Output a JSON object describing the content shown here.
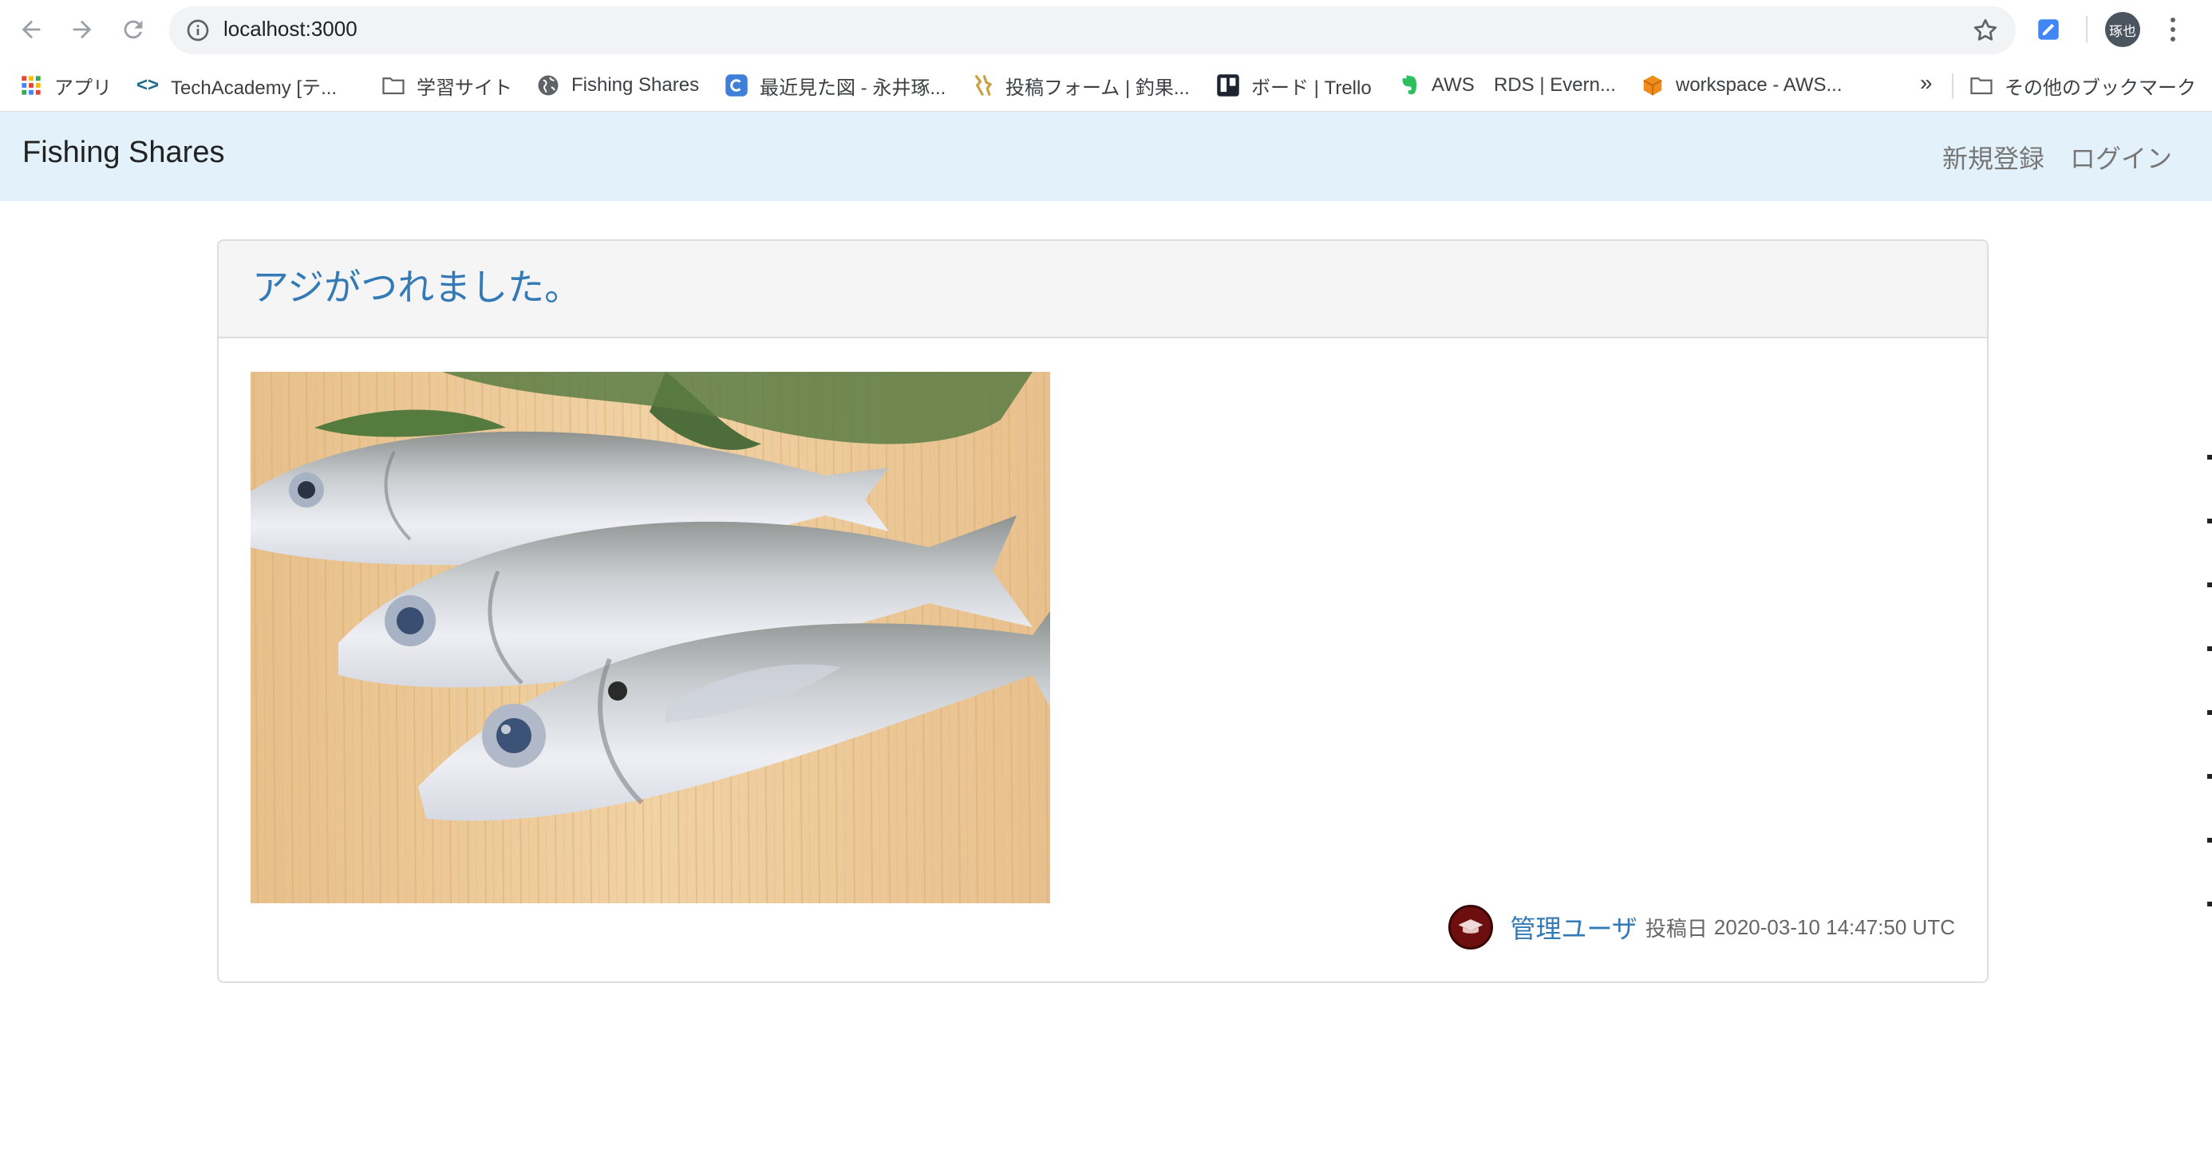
{
  "browser": {
    "url": "localhost:3000",
    "profile_initials": "琢也"
  },
  "bookmarks": {
    "items": [
      {
        "label": "アプリ",
        "icon": "apps-grid-icon"
      },
      {
        "label": "TechAcademy [テ...",
        "icon": "code-brackets-icon"
      },
      {
        "label": "学習サイト",
        "icon": "folder-icon"
      },
      {
        "label": "Fishing Shares",
        "icon": "globe-icon"
      },
      {
        "label": "最近見た図 - 永井琢...",
        "icon": "cacoo-icon"
      },
      {
        "label": "投稿フォーム | 釣果...",
        "icon": "bookmark-figure-icon"
      },
      {
        "label": "ボード | Trello",
        "icon": "trello-icon"
      },
      {
        "label": "AWS",
        "icon": "evernote-icon"
      },
      {
        "label": "RDS | Evern...",
        "icon": ""
      },
      {
        "label": "workspace - AWS...",
        "icon": "aws-cube-icon"
      }
    ],
    "more_label": "»",
    "other_label": "その他のブックマーク"
  },
  "app": {
    "brand": "Fishing Shares",
    "nav": {
      "signup": "新規登録",
      "login": "ログイン"
    }
  },
  "post": {
    "title": "アジがつれました。",
    "user_name": "管理ユーザ",
    "posted_label": "投稿日",
    "posted_at": "2020-03-10 14:47:50 UTC"
  },
  "colors": {
    "link": "#337ab7",
    "navbar_bg": "#e3f2fa",
    "card_header_bg": "#f5f5f5"
  }
}
